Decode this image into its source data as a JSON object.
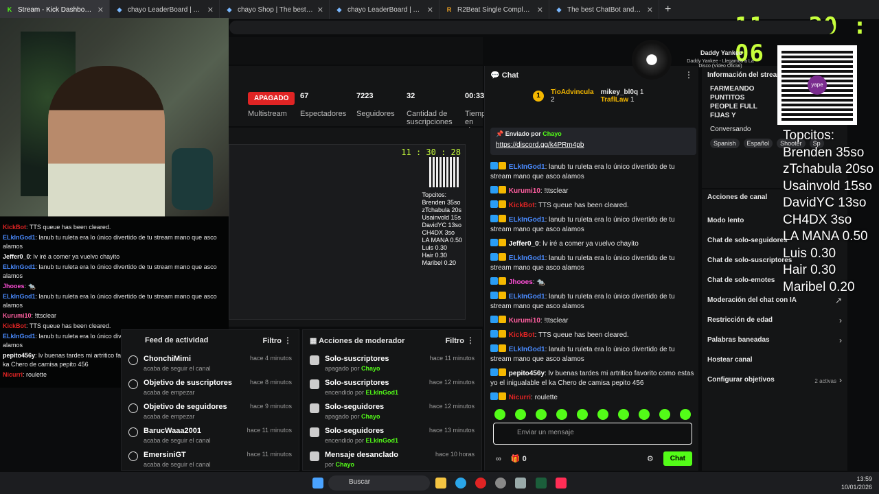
{
  "tabs": [
    {
      "label": "Stream - Kick Dashboard",
      "fav": "K",
      "color": "#53fc18"
    },
    {
      "label": "chayo LeaderBoard | The best Chat",
      "fav": "◆",
      "color": "#7ab8ff"
    },
    {
      "label": "chayo Shop | The best ChatBot and",
      "fav": "◆",
      "color": "#7ab8ff"
    },
    {
      "label": "chayo LeaderBoard | The best Cha",
      "fav": "◆",
      "color": "#7ab8ff"
    },
    {
      "label": "R2Beat Single Completo 2023 - Ju",
      "fav": "R",
      "color": "#f5a623"
    },
    {
      "label": "The best ChatBot and Widgets for",
      "fav": "◆",
      "color": "#7ab8ff"
    }
  ],
  "clock": "11 : 30 : 06",
  "dashboard": {
    "status": "APAGADO",
    "multistream": "Multistream",
    "stats": [
      {
        "value": "67",
        "label": "Espectadores"
      },
      {
        "value": "7223",
        "label": "Seguidores"
      },
      {
        "value": "32",
        "label": "Cantidad de suscripciones"
      },
      {
        "value": "00:33",
        "label": "Tiempo en vivo"
      }
    ]
  },
  "preview": {
    "clock": "11 : 30 : 28",
    "topcitos": "Topcitos:\nBrenden 35so\nzTchabula 20s\nUsainvold 15s\nDavidYC 13so\nCH4DX 3so\nLA MANA 0.50\nLuis 0.30\nHair 0.30\nMaribel 0.20"
  },
  "overlay_chat": [
    {
      "user": "KickBot",
      "color": "#e02424",
      "text": ": TTS queue has been cleared."
    },
    {
      "user": "ELkInGod1",
      "color": "#4a8bff",
      "text": ": lanub tu ruleta era lo único divertido de tu stream mano que asco alamos"
    },
    {
      "user": "Jeffer0_0",
      "color": "#fff",
      "text": ": lv iré a comer ya vuelvo chayito"
    },
    {
      "user": "ELkInGod1",
      "color": "#4a8bff",
      "text": ": lanub tu ruleta era lo único divertido de tu stream mano que asco alamos"
    },
    {
      "user": "Jhooes",
      "color": "#ff4fd8",
      "text": ": 🐀"
    },
    {
      "user": "ELkInGod1",
      "color": "#4a8bff",
      "text": ": lanub tu ruleta era lo único divertido de tu stream mano que asco alamos"
    },
    {
      "user": "Kurumi10",
      "color": "#ff5fa0",
      "text": ": !ttsclear"
    },
    {
      "user": "KickBot",
      "color": "#e02424",
      "text": ": TTS queue has been cleared."
    },
    {
      "user": "ELkInGod1",
      "color": "#4a8bff",
      "text": ": lanub tu ruleta era lo único divertido de tu stream mano que asco alamos"
    },
    {
      "user": "pepito456y",
      "color": "#fff",
      "text": ": lv buenas tardes mi artritico favorito como estas yo el inigualable el ka Chero de camisa pepito 456"
    },
    {
      "user": "Nicurri",
      "color": "#e02424",
      "text": ": roulette"
    }
  ],
  "activity": {
    "title": "Feed de actividad",
    "filter": "Filtro",
    "items": [
      {
        "title": "ChonchiMimi",
        "sub": "acaba de seguir el canal",
        "time": "hace 4 minutos"
      },
      {
        "title": "Objetivo de suscriptores",
        "sub": "acaba de empezar",
        "time": "hace 8 minutos"
      },
      {
        "title": "Objetivo de seguidores",
        "sub": "acaba de empezar",
        "time": "hace 9 minutos"
      },
      {
        "title": "BarucWaaa2001",
        "sub": "acaba de seguir el canal",
        "time": "hace 11 minutos"
      },
      {
        "title": "EmersiniGT",
        "sub": "acaba de seguir el canal",
        "time": "hace 11 minutos"
      }
    ]
  },
  "modactions": {
    "title": "Acciones de moderador",
    "filter": "Filtro",
    "items": [
      {
        "title": "Solo-suscriptores",
        "pre": "apagado por ",
        "by": "Chayo",
        "time": "hace 11 minutos"
      },
      {
        "title": "Solo-suscriptores",
        "pre": "encendido por ",
        "by": "ELkInGod1",
        "time": "hace 12 minutos"
      },
      {
        "title": "Solo-seguidores",
        "pre": "apagado por ",
        "by": "Chayo",
        "time": "hace 12 minutos"
      },
      {
        "title": "Solo-seguidores",
        "pre": "encendido por ",
        "by": "ELkInGod1",
        "time": "hace 13 minutos"
      },
      {
        "title": "Mensaje desanclado",
        "pre": "por ",
        "by": "Chayo",
        "time": "hace 10 horas"
      }
    ]
  },
  "chat": {
    "title": "Chat",
    "gifters": [
      {
        "name": "TioAdvincula",
        "count": "2"
      },
      {
        "name": "mikey_bl0q",
        "count": "1"
      },
      {
        "name": "TraflLaw",
        "count": "1"
      }
    ],
    "rank": "1",
    "pinned": {
      "by_label": "Enviado por",
      "by": "Chayo",
      "link": "https://discord.gg/k4PRm4pb"
    },
    "messages": [
      {
        "user": "ELkInGod1",
        "color": "#4a8bff",
        "text": ": lanub tu ruleta era lo único divertido de tu stream mano que asco alamos"
      },
      {
        "user": "Kurumi10",
        "color": "#ff5fa0",
        "text": ": !ttsclear"
      },
      {
        "user": "KickBot",
        "color": "#e02424",
        "text": ": TTS queue has been cleared."
      },
      {
        "user": "ELkInGod1",
        "color": "#4a8bff",
        "text": ": lanub tu ruleta era lo único divertido de tu stream mano que asco alamos"
      },
      {
        "user": "Jeffer0_0",
        "color": "#fff",
        "text": ": lv iré a comer ya vuelvo chayito"
      },
      {
        "user": "ELkInGod1",
        "color": "#4a8bff",
        "text": ": lanub tu ruleta era lo único divertido de tu stream mano que asco alamos"
      },
      {
        "user": "Jhooes",
        "color": "#ff4fd8",
        "text": ": 🐀"
      },
      {
        "user": "ELkInGod1",
        "color": "#4a8bff",
        "text": ": lanub tu ruleta era lo único divertido de tu stream mano que asco alamos"
      },
      {
        "user": "Kurumi10",
        "color": "#ff5fa0",
        "text": ": !ttsclear"
      },
      {
        "user": "KickBot",
        "color": "#e02424",
        "text": ": TTS queue has been cleared."
      },
      {
        "user": "ELkInGod1",
        "color": "#4a8bff",
        "text": ": lanub tu ruleta era lo único divertido de tu stream mano que asco alamos"
      },
      {
        "user": "pepito456y",
        "color": "#fff",
        "text": ": lv buenas tardes mi artritico favorito como estas yo el inigualable el ka Chero de camisa pepito 456"
      },
      {
        "user": "Nicurri",
        "color": "#e02424",
        "text": ": roulette"
      }
    ],
    "input_placeholder": "Enviar un mensaje",
    "infinity": "∞",
    "gift_count": "0",
    "send": "Chat"
  },
  "info": {
    "title": "Información del stream",
    "stream_title": "FARMEANDO PUNTITOS PEOPLE FULL FIJAS Y",
    "category": "Conversando",
    "tags": [
      "Spanish",
      "Español",
      "Shooter",
      "Sp"
    ]
  },
  "channel_actions": {
    "title": "Acciones de canal",
    "items": [
      {
        "label": "Modo lento",
        "arrow": ""
      },
      {
        "label": "Chat de solo-seguidores",
        "arrow": ""
      },
      {
        "label": "Chat de solo-suscriptores",
        "arrow": ""
      },
      {
        "label": "Chat de solo-emotes",
        "arrow": ""
      },
      {
        "label": "Moderación del chat con IA",
        "arrow": "↗"
      },
      {
        "label": "Restricción de edad",
        "arrow": "›"
      },
      {
        "label": "Palabras baneadas",
        "arrow": "›"
      },
      {
        "label": "Hostear canal",
        "arrow": ""
      },
      {
        "label": "Configurar objetivos",
        "arrow": "›",
        "extra": "2 activas"
      }
    ]
  },
  "topcitos": "Topcitos:\nBrenden 35so\nzTchabula 20so\nUsainvold 15so\nDavidYC 13so\nCH4DX 3so\nLA MANA 0.50\nLuis 0.30\nHair 0.30\nMaribel 0.20",
  "music": {
    "artist": "Daddy Yankee",
    "song": "Daddy Yankee - Llegamos a La Disco (Video Oficial)"
  },
  "taskbar": {
    "search": "Buscar",
    "time": "13:59",
    "date": "10/01/2026"
  }
}
